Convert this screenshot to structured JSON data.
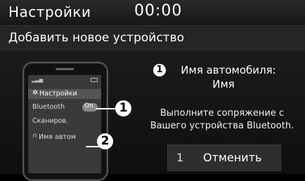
{
  "statusbar": {
    "title": "Настройки",
    "clock": "00:00"
  },
  "header": {
    "title": "Добавить новое устройство"
  },
  "phone": {
    "settings_label": "Настройки",
    "bluetooth_label": "Bluetooth",
    "toggle_label": "On",
    "scan_label": "Сканиров.",
    "device_label": "Имя автом"
  },
  "markers": {
    "m1": "1",
    "m2": "2"
  },
  "instructions": {
    "step_marker": "1",
    "line1": "Имя автомобиля:",
    "line2": "Имя",
    "pair_line1": "Выполните сопряжение с",
    "pair_line2": "Вашего устройства Bluetooth."
  },
  "cancel_button": {
    "key": "1",
    "label": "Отменить"
  }
}
